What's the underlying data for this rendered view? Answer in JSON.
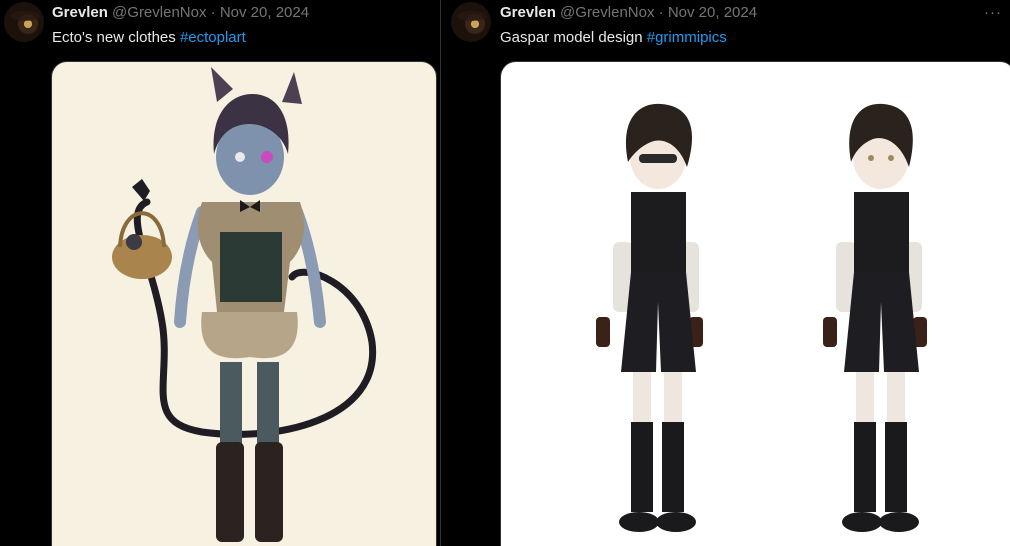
{
  "posts": [
    {
      "author": {
        "name": "Grevlen",
        "handle": "@GrevlenNox",
        "date": "Nov 20, 2024",
        "separator": "·"
      },
      "text": "Ecto's new clothes ",
      "hashtag": "#ectoplart",
      "media": {
        "description_icon": "character-art-image"
      }
    },
    {
      "author": {
        "name": "Grevlen",
        "handle": "@GrevlenNox",
        "date": "Nov 20, 2024",
        "separator": "·"
      },
      "text": "Gaspar model design ",
      "hashtag": "#grimmipics",
      "more_icon": "more-options-icon",
      "media": {
        "description_icon": "character-art-image"
      }
    }
  ],
  "colors": {
    "background": "#000000",
    "text_primary": "#e7e9ea",
    "text_secondary": "#71767b",
    "hashtag": "#1d9bf0",
    "left_media_bg": "#f6f1e0",
    "right_media_bg": "#ffffff"
  }
}
